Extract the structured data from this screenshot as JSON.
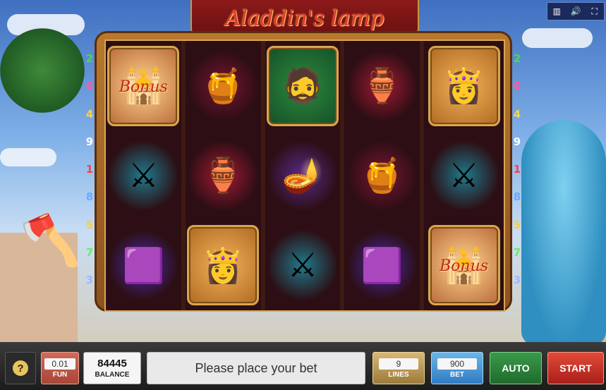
{
  "title": "Aladdin's lamp",
  "toolbar": {
    "icons": [
      "bars-icon",
      "speaker-icon",
      "fullscreen-icon"
    ]
  },
  "lines": {
    "left": [
      "2",
      "6",
      "4",
      "9",
      "1",
      "8",
      "5",
      "7",
      "3"
    ],
    "right": [
      "2",
      "6",
      "4",
      "9",
      "1",
      "8",
      "5",
      "7",
      "3"
    ],
    "colors": {
      "1": "#ff4040",
      "2": "#44dd44",
      "3": "#9fb8ff",
      "4": "#ffd040",
      "5": "#ffcc33",
      "6": "#ff5aa0",
      "7": "#66ee66",
      "8": "#66aaff",
      "9": "#ffffff"
    }
  },
  "reels": [
    [
      "bonus",
      "swords",
      "carpet"
    ],
    [
      "pot",
      "vase",
      "princess"
    ],
    [
      "aladdin",
      "lamp",
      "swords"
    ],
    [
      "vase",
      "pot",
      "carpet"
    ],
    [
      "princess",
      "swords",
      "bonus"
    ]
  ],
  "symbols": {
    "bonus": {
      "text": "Bonus",
      "icon": "palace-icon"
    },
    "pot": {
      "icon": "treasure-pot-icon"
    },
    "aladdin": {
      "icon": "aladdin-icon"
    },
    "vase": {
      "icon": "vase-icon"
    },
    "princess": {
      "icon": "princess-icon"
    },
    "swords": {
      "icon": "crossed-swords-icon"
    },
    "lamp": {
      "icon": "magic-lamp-icon"
    },
    "carpet": {
      "icon": "flying-carpet-icon"
    }
  },
  "controls": {
    "help_label": "?",
    "fun_value": "0.01",
    "fun_label": "FUN",
    "balance_value": "84445",
    "balance_label": "BALANCE",
    "message": "Please place your bet",
    "lines_value": "9",
    "lines_label": "LINES",
    "bet_value": "900",
    "bet_label": "BET",
    "auto_label": "AUTO",
    "start_label": "START"
  }
}
